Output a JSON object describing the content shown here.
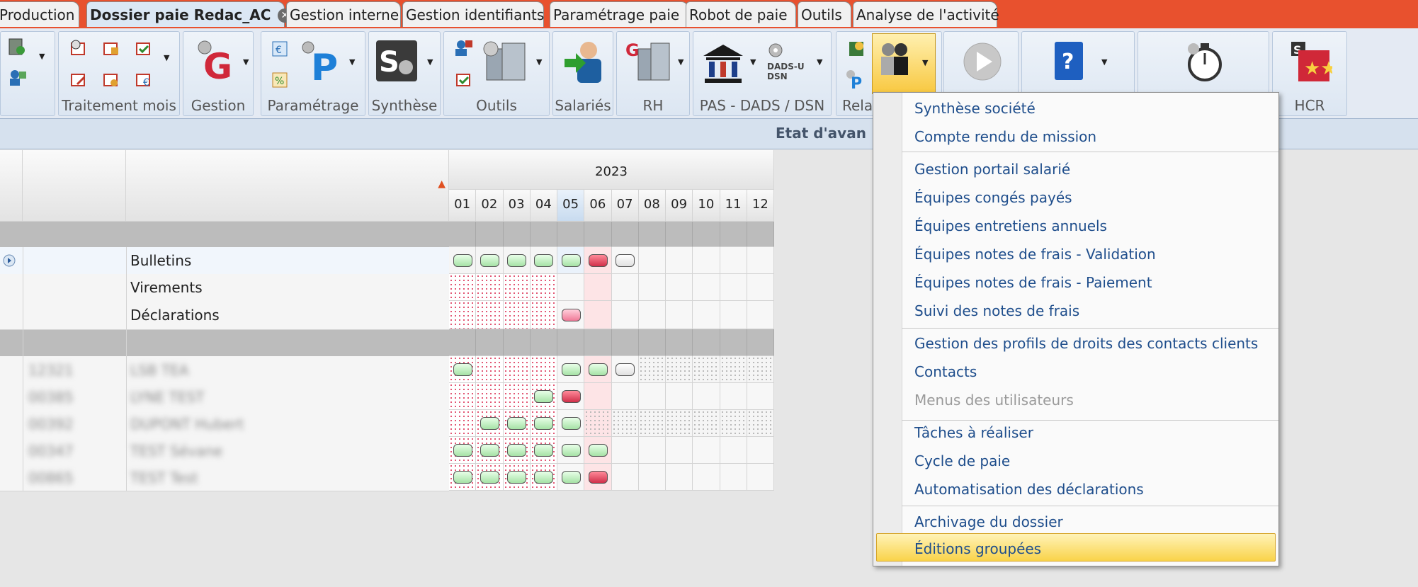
{
  "tabs": [
    "Production",
    "Dossier paie Redac_AC",
    "Gestion interne",
    "Gestion identifiants",
    "Paramétrage paie",
    "Robot de paie",
    "Outils",
    "Analyse de l'activité"
  ],
  "ribbon_groups": [
    "Traitement mois",
    "Gestion",
    "Paramétrage",
    "Synthèse",
    "Outils",
    "Salariés",
    "RH",
    "PAS - DADS / DSN",
    "Relat",
    "HCR"
  ],
  "ribbon_text": {
    "dads": "DADS-U",
    "dsn": "DSN"
  },
  "band_title": "Etat d'avan",
  "grid": {
    "year": "2023",
    "months": [
      "01",
      "02",
      "03",
      "04",
      "05",
      "06",
      "07",
      "08",
      "09",
      "10",
      "11",
      "12"
    ],
    "rows": [
      {
        "label": "Bulletins"
      },
      {
        "label": "Virements"
      },
      {
        "label": "Déclarations"
      }
    ],
    "employees": [
      {
        "code": "12321",
        "name": "LSB TEA"
      },
      {
        "code": "00385",
        "name": "LYNE TEST"
      },
      {
        "code": "00392",
        "name": "DUPONT Hubert"
      },
      {
        "code": "00347",
        "name": "TEST Sévane"
      },
      {
        "code": "00865",
        "name": "TEST Test"
      }
    ]
  },
  "menu": {
    "items": [
      {
        "label": "Synthèse société"
      },
      {
        "label": "Compte rendu de mission"
      },
      {
        "label": "Gestion portail salarié"
      },
      {
        "label": "Équipes congés payés"
      },
      {
        "label": "Équipes entretiens annuels"
      },
      {
        "label": "Équipes notes de frais - Validation"
      },
      {
        "label": "Équipes notes de frais - Paiement"
      },
      {
        "label": "Suivi des notes de frais"
      },
      {
        "label": "Gestion des profils de droits des contacts clients"
      },
      {
        "label": "Contacts"
      },
      {
        "label": "Menus des utilisateurs",
        "disabled": true
      },
      {
        "label": "Tâches à réaliser"
      },
      {
        "label": "Cycle de paie"
      },
      {
        "label": "Automatisation des déclarations"
      },
      {
        "label": "Archivage du dossier"
      },
      {
        "label": "Éditions groupées",
        "highlighted": true
      }
    ]
  }
}
